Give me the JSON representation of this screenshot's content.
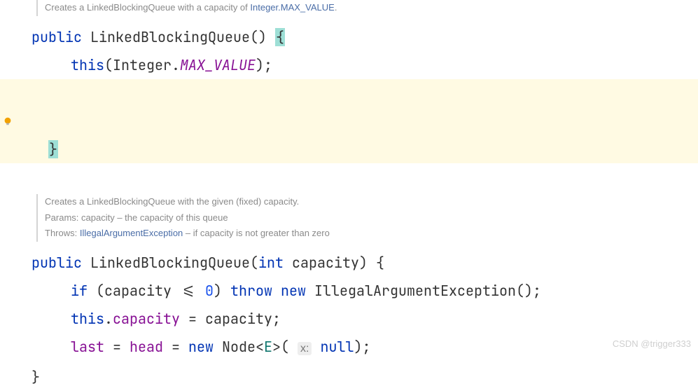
{
  "doc1": {
    "line1_prefix": "Creates a LinkedBlockingQueue with a capacity of ",
    "line1_link": "Integer.MAX_VALUE",
    "line1_suffix": "."
  },
  "ctor1": {
    "public": "public",
    "name": "LinkedBlockingQueue",
    "parens": "()",
    "openBrace": "{",
    "thisKw": "this",
    "intType": "Integer",
    "dot": ".",
    "maxVal": "MAX_VALUE",
    "close": ");",
    "closeBrace": "}"
  },
  "doc2": {
    "line1": "Creates a LinkedBlockingQueue with the given (fixed) capacity.",
    "paramsLabel": "Params:",
    "paramsText": " capacity – the capacity of this queue",
    "throwsLabel": "Throws:",
    "throwsLink": "IllegalArgumentException",
    "throwsText": " – if capacity is not greater than zero"
  },
  "ctor2": {
    "public": "public",
    "name": "LinkedBlockingQueue",
    "lp": "(",
    "intKw": "int",
    "param": " capacity",
    "rp": ") {",
    "ifKw": "if",
    "cond": " (capacity <= ",
    "zero": "0",
    "condEnd": ") ",
    "throwKw": "throw",
    "sp": " ",
    "newKw": "new",
    "exType": " IllegalArgumentException();",
    "thisKw": "this",
    "dot": ".",
    "capField": "capacity",
    "assign1": " = capacity;",
    "lastField": "last",
    "eq1": " = ",
    "headField": "head",
    "eq2": " = ",
    "newKw2": "new",
    "nodeType": " Node",
    "genOpen": "<",
    "genE": "E",
    "genClose": ">",
    "argOpen": "( ",
    "hint": "x:",
    "nullKw": "null",
    "argClose": ");",
    "closeBrace": "}"
  },
  "watermark": "CSDN @trigger333"
}
